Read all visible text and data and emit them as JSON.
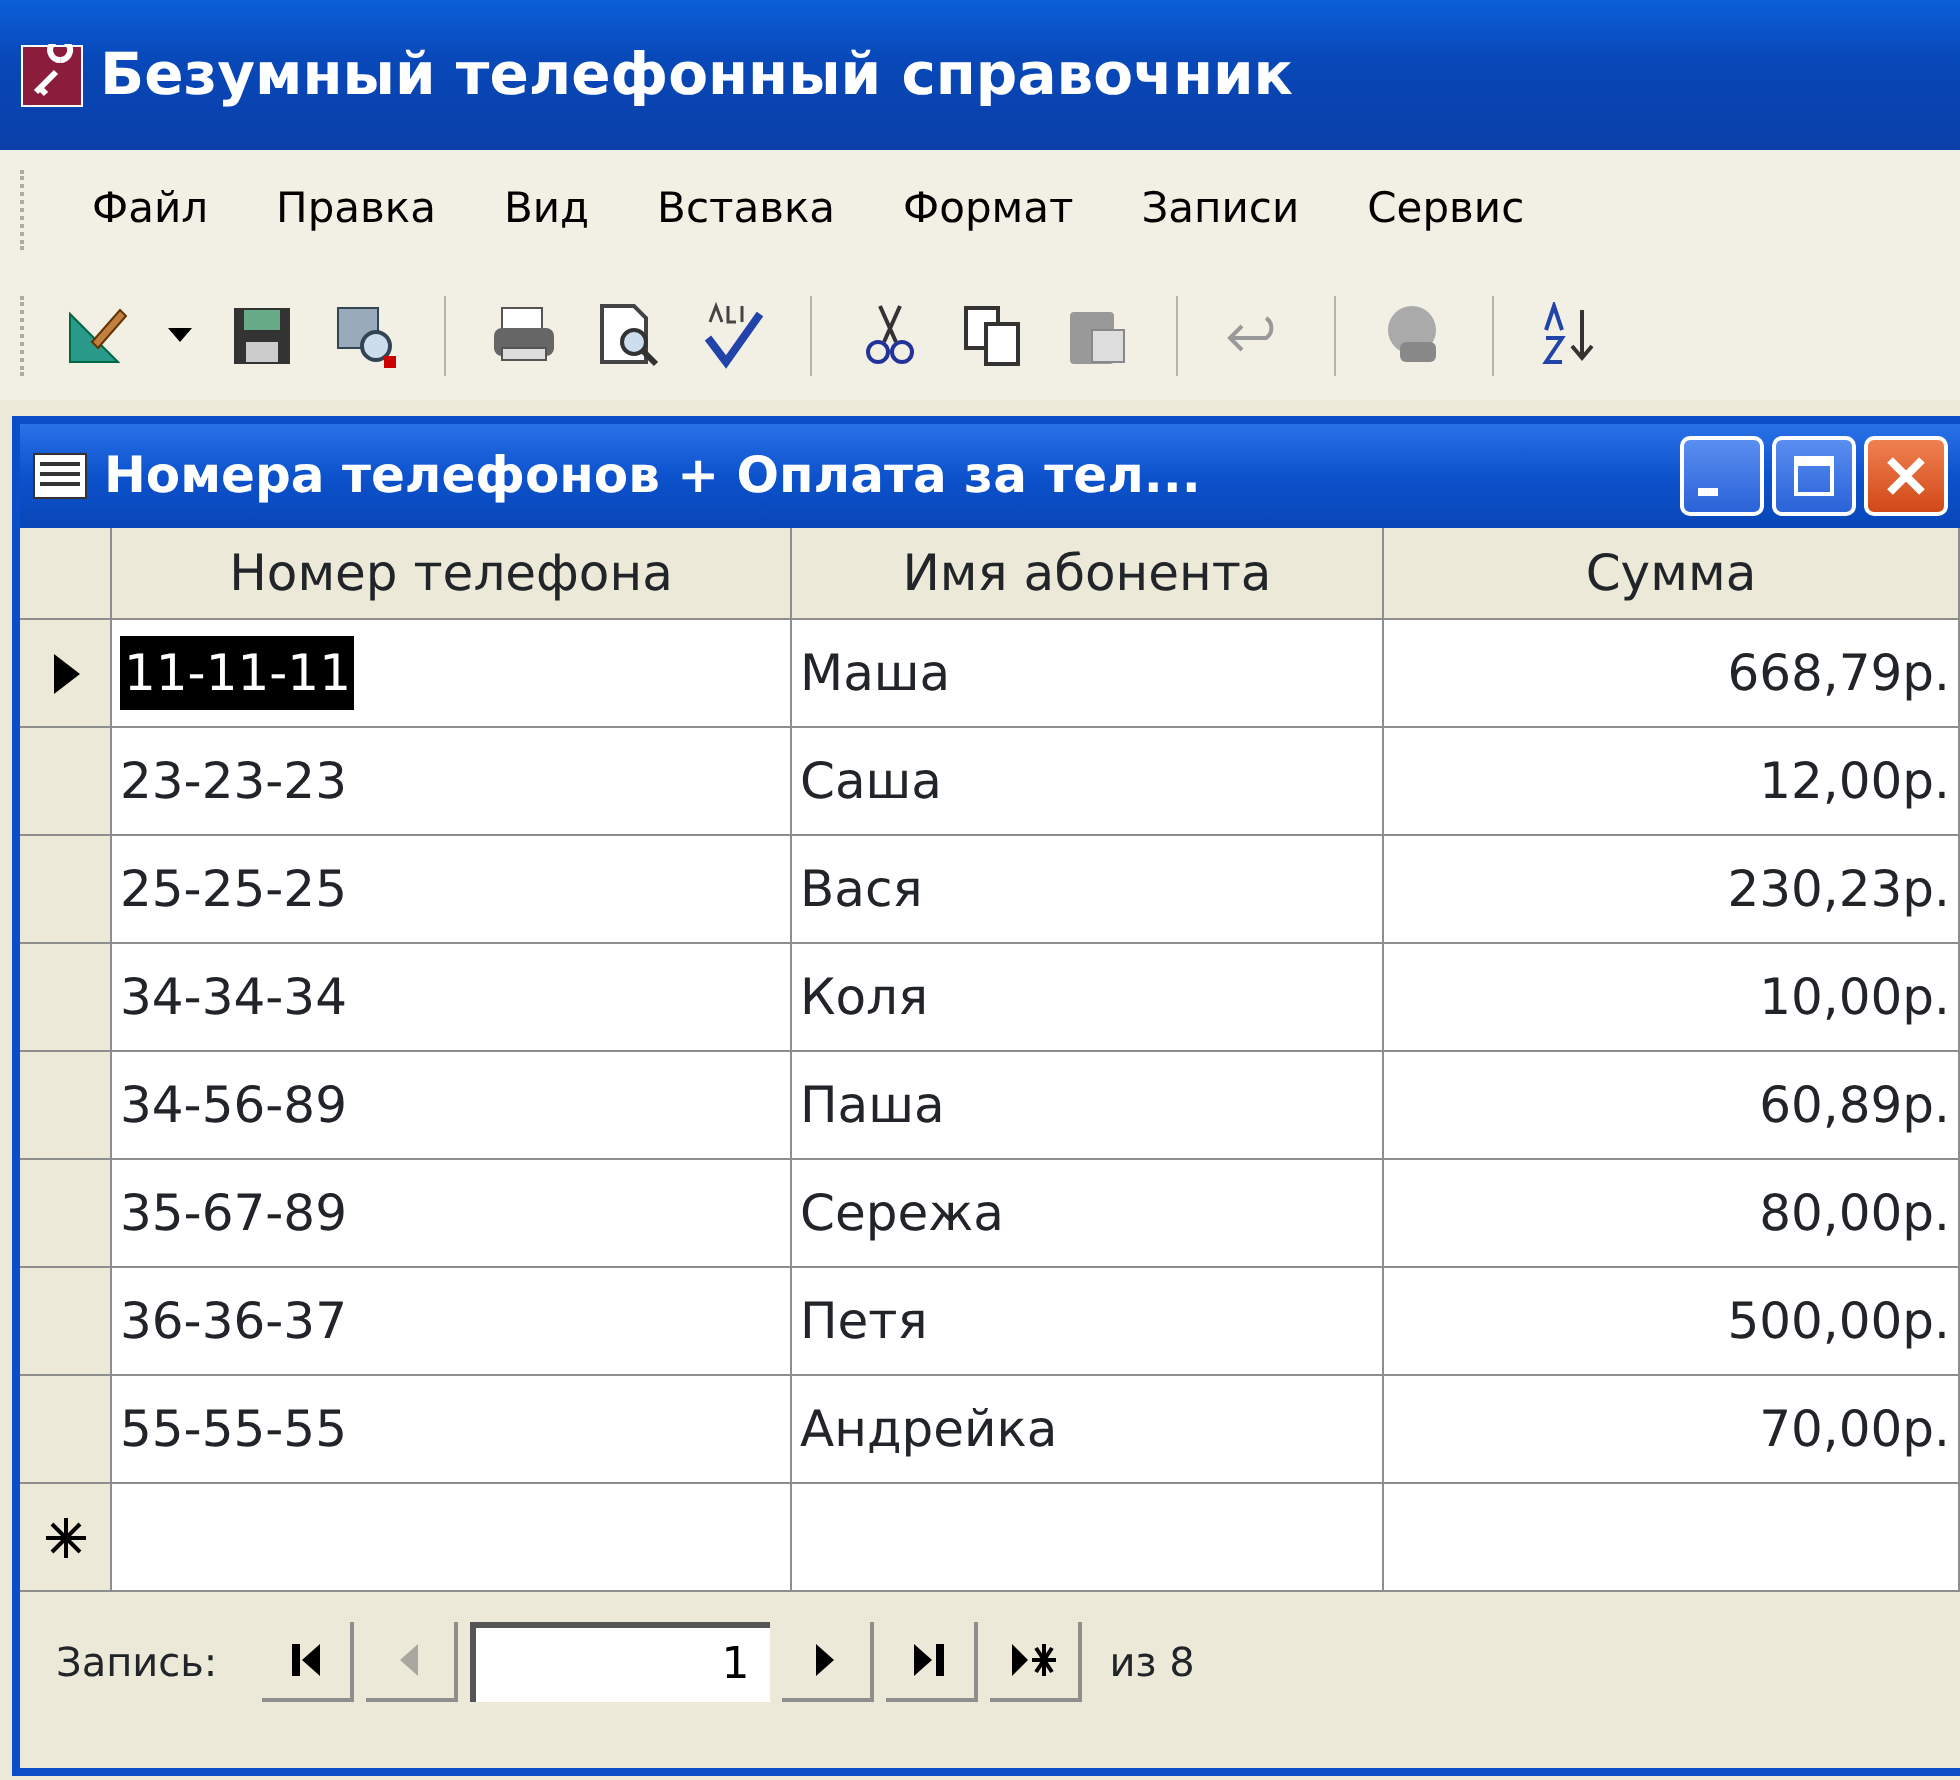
{
  "app": {
    "title": "Безумный телефонный справочник"
  },
  "menu": [
    {
      "label": "Файл"
    },
    {
      "label": "Правка"
    },
    {
      "label": "Вид"
    },
    {
      "label": "Вставка"
    },
    {
      "label": "Формат"
    },
    {
      "label": "Записи"
    },
    {
      "label": "Сервис"
    }
  ],
  "form": {
    "title": "Номера телефонов + Оплата за тел...",
    "columns": [
      "Номер телефона",
      "Имя абонента",
      "Сумма"
    ],
    "rows": [
      {
        "current": true,
        "cells": [
          {
            "text": "11-11-11",
            "selected": true
          },
          {
            "text": "Маша",
            "selected": false
          },
          {
            "text": "668,79р.",
            "selected": false
          }
        ]
      },
      {
        "current": false,
        "cells": [
          {
            "text": "23-23-23",
            "selected": false
          },
          {
            "text": "Саша",
            "selected": false
          },
          {
            "text": "12,00р.",
            "selected": false
          }
        ]
      },
      {
        "current": false,
        "cells": [
          {
            "text": "25-25-25",
            "selected": false
          },
          {
            "text": "Вася",
            "selected": false
          },
          {
            "text": "230,23р.",
            "selected": false
          }
        ]
      },
      {
        "current": false,
        "cells": [
          {
            "text": "34-34-34",
            "selected": false
          },
          {
            "text": "Коля",
            "selected": false
          },
          {
            "text": "10,00р.",
            "selected": false
          }
        ]
      },
      {
        "current": false,
        "cells": [
          {
            "text": "34-56-89",
            "selected": false
          },
          {
            "text": "Паша",
            "selected": false
          },
          {
            "text": "60,89р.",
            "selected": false
          }
        ]
      },
      {
        "current": false,
        "cells": [
          {
            "text": "35-67-89",
            "selected": false
          },
          {
            "text": "Сережа",
            "selected": false
          },
          {
            "text": "80,00р.",
            "selected": false
          }
        ]
      },
      {
        "current": false,
        "cells": [
          {
            "text": "36-36-37",
            "selected": false
          },
          {
            "text": "Петя",
            "selected": false
          },
          {
            "text": "500,00р.",
            "selected": false
          }
        ]
      },
      {
        "current": false,
        "cells": [
          {
            "text": "55-55-55",
            "selected": false
          },
          {
            "text": "Андрейка",
            "selected": false
          },
          {
            "text": "70,00р.",
            "selected": false
          }
        ]
      }
    ],
    "navigator": {
      "label": "Запись:",
      "record": "1",
      "total": "из 8",
      "buttons": [
        {
          "kind": "first",
          "disabled": false
        },
        {
          "kind": "prev",
          "disabled": true
        },
        {
          "kind": "next",
          "disabled": false
        },
        {
          "kind": "last",
          "disabled": false
        },
        {
          "kind": "new",
          "disabled": false
        }
      ]
    }
  }
}
